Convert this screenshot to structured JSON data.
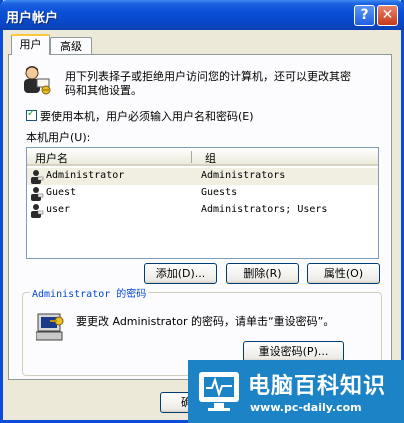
{
  "window": {
    "title": "用户帐户",
    "help_button": "?",
    "close_button": "✕"
  },
  "tabs": [
    {
      "label": "用户",
      "active": true
    },
    {
      "label": "高级",
      "active": false
    }
  ],
  "intro": {
    "line1": "用下列表择子或拒绝用户访问您的计算机，还可以更改其密",
    "line2": "码和其他设置。"
  },
  "checkbox": {
    "label_main": "要使用本机，用户必须输入用户名和密码",
    "label_key": "(E)",
    "checked": true
  },
  "users_label": {
    "text": "本机用户",
    "key": "(U)",
    "colon": ":"
  },
  "table": {
    "columns": [
      "用户名",
      "组"
    ],
    "rows": [
      {
        "name": "Administrator",
        "group": "Administrators",
        "selected": true
      },
      {
        "name": "Guest",
        "group": "Guests",
        "selected": false
      },
      {
        "name": "user",
        "group": "Administrators; Users",
        "selected": false
      }
    ]
  },
  "buttons": {
    "add": "添加(D)...",
    "delete": "删除(R)",
    "properties": "属性(O)",
    "reset_password": "重设密码(P)...",
    "ok_partial": "确"
  },
  "password_group": {
    "title": "Administrator 的密码",
    "text": "要更改 Administrator 的密码，请单击“重设密码”。"
  },
  "watermark": {
    "title": "电脑百科知识",
    "url": "www.pc-daily.com"
  },
  "colors": {
    "titlebar": "#0a4fd8",
    "dialog_bg": "#ece9d8",
    "panel_bg": "#fcfcfe",
    "group_title": "#0046d5",
    "watermark_bg": "#1d83c7"
  }
}
